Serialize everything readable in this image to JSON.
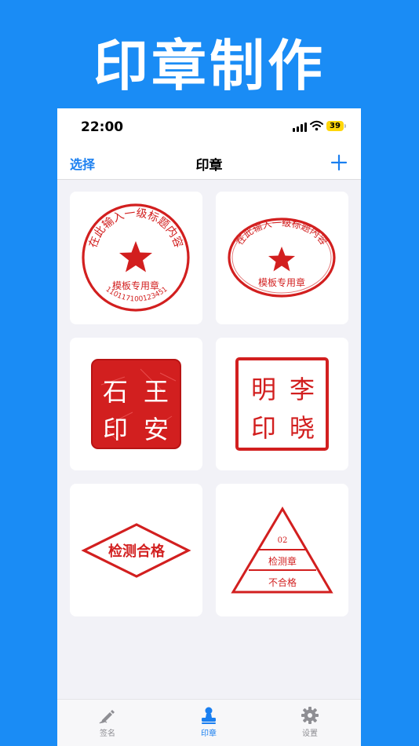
{
  "hero": {
    "title": "印章制作"
  },
  "status": {
    "time": "22:00",
    "battery": "39"
  },
  "nav": {
    "left": "选择",
    "title": "印章"
  },
  "stamps": {
    "s1": {
      "top": "在此输入一级标题内容",
      "middle": "模板专用章",
      "bottom": "110117100123451"
    },
    "s2": {
      "top": "在此输入一级标题内容",
      "middle": "模板专用章"
    },
    "s3": {
      "c1": "石",
      "c2": "王",
      "c3": "印",
      "c4": "安"
    },
    "s4": {
      "c1": "明",
      "c2": "李",
      "c3": "印",
      "c4": "晓"
    },
    "s5": {
      "text": "检测合格"
    },
    "s6": {
      "code": "02",
      "line1": "检测章",
      "line2": "不合格"
    }
  },
  "colors": {
    "accent": "#1a7ff0",
    "stamp_red": "#d21f1f",
    "hero_bg": "#1a8cf5"
  },
  "tabs": [
    {
      "label": "签名",
      "icon": "signature-pen-icon",
      "active": false
    },
    {
      "label": "印章",
      "icon": "stamp-icon",
      "active": true
    },
    {
      "label": "设置",
      "icon": "gear-icon",
      "active": false
    }
  ]
}
